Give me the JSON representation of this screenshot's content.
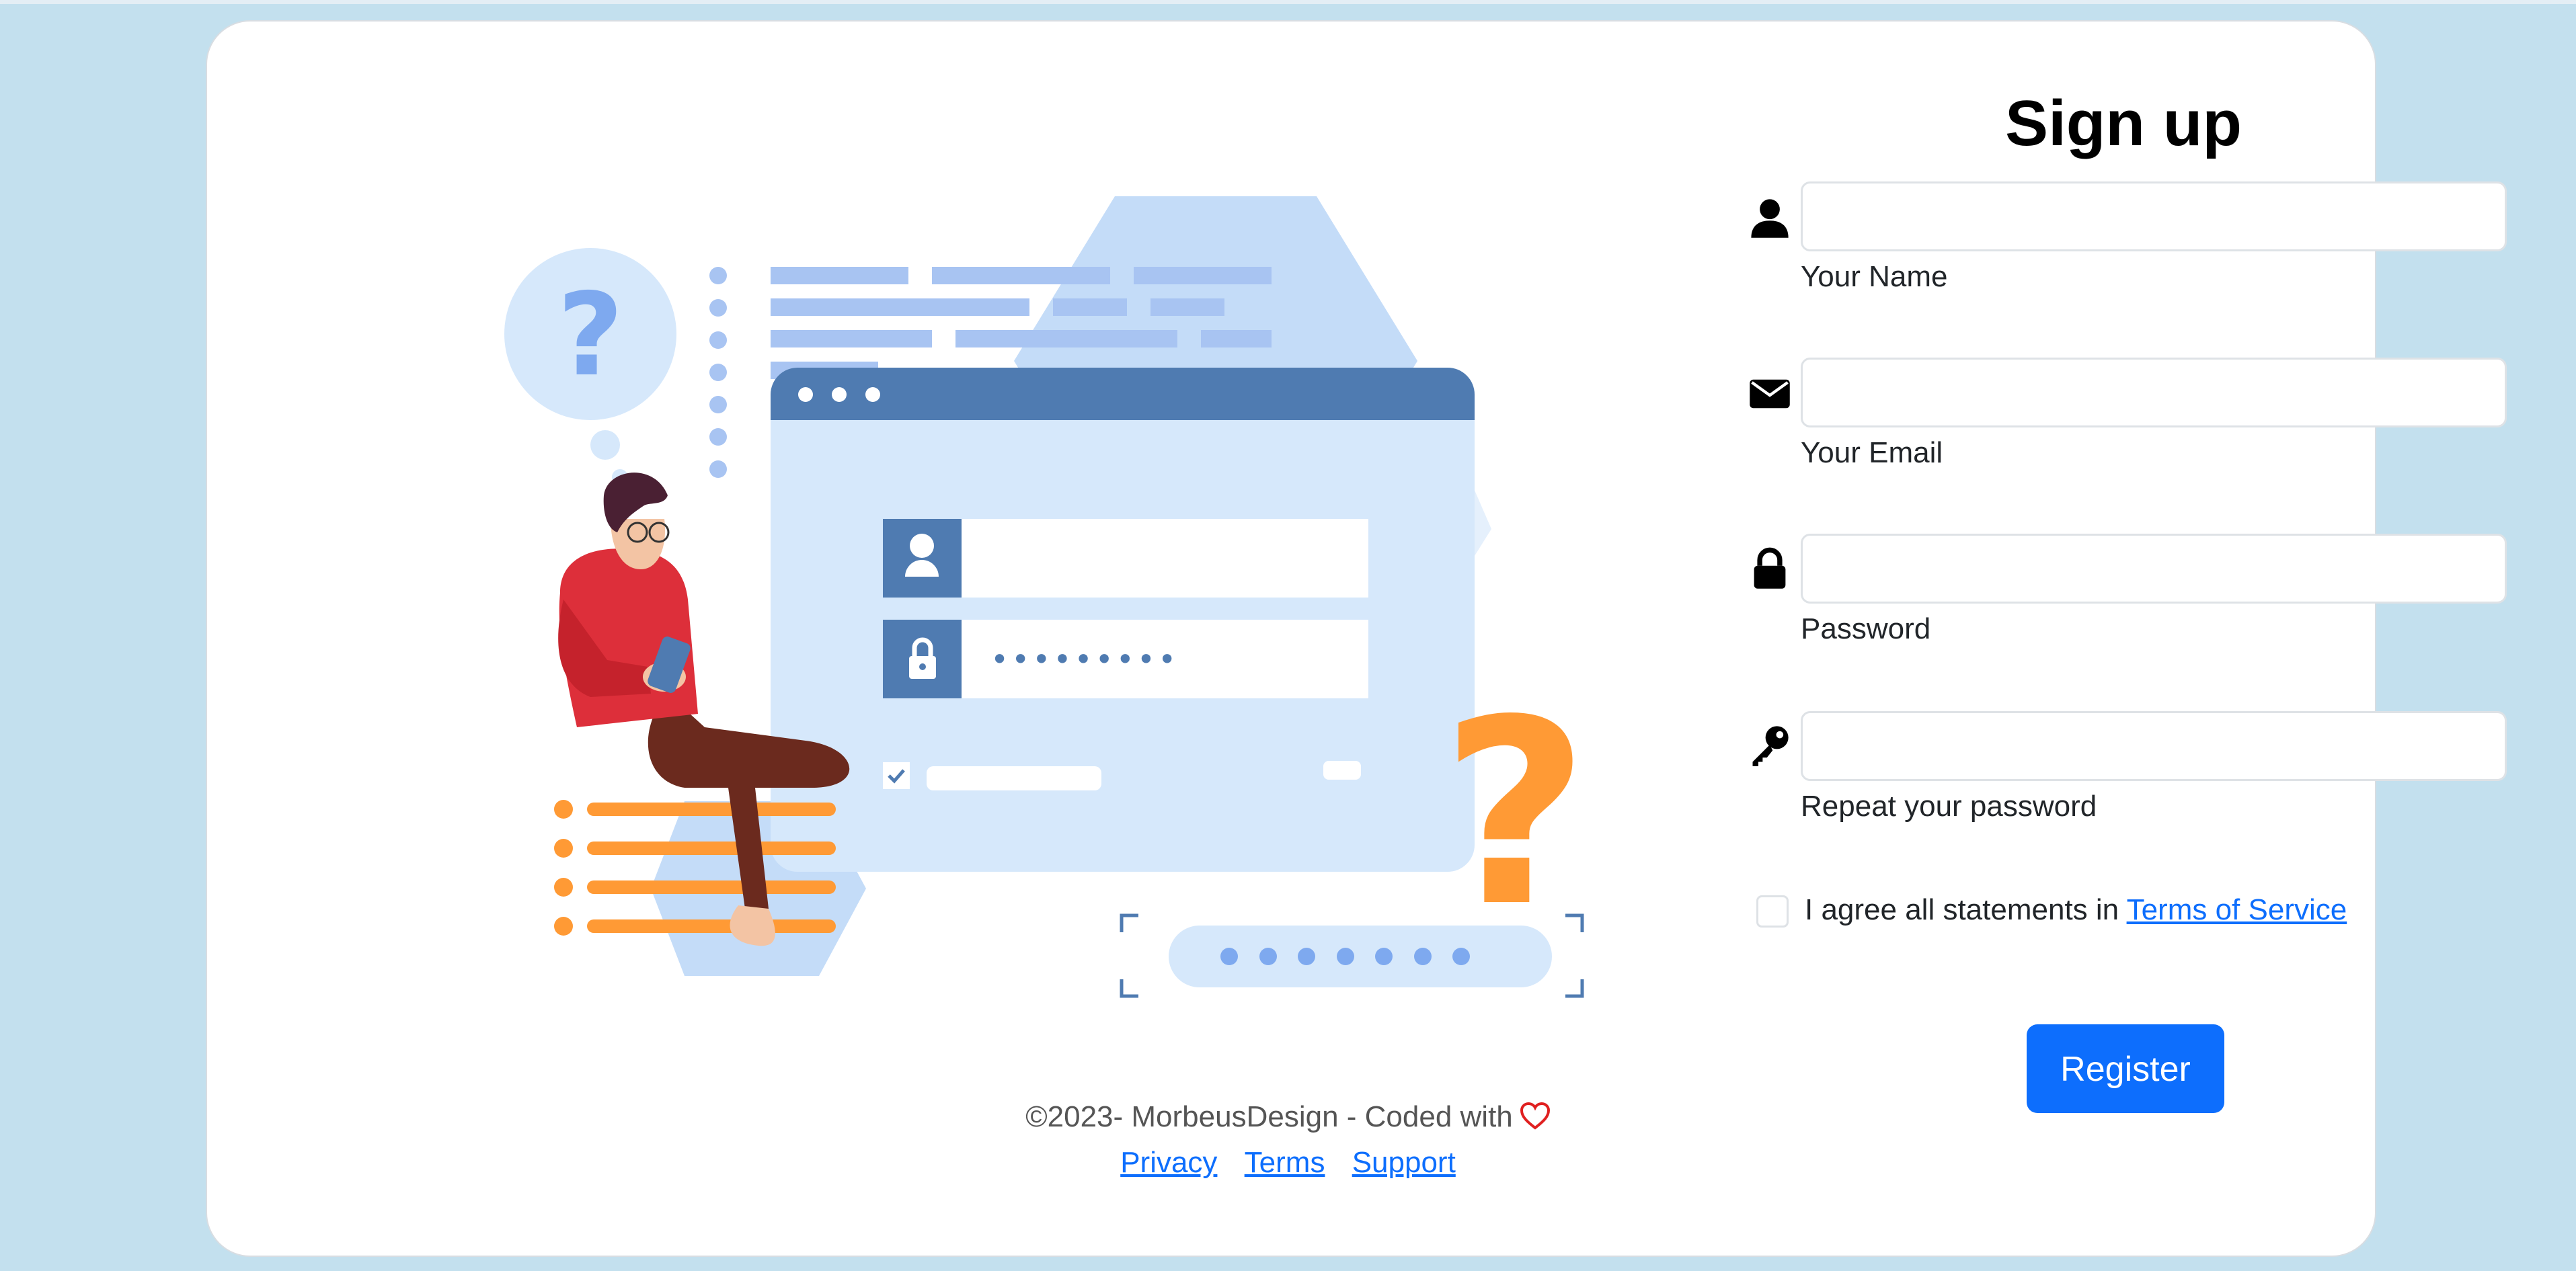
{
  "form": {
    "title": "Sign up",
    "fields": [
      {
        "label": "Your Name",
        "value": "",
        "icon": "user-icon"
      },
      {
        "label": "Your Email",
        "value": "",
        "icon": "envelope-icon"
      },
      {
        "label": "Password",
        "value": "",
        "icon": "lock-icon"
      },
      {
        "label": "Repeat your password",
        "value": "",
        "icon": "key-icon"
      }
    ],
    "agree_text": "I agree all statements in ",
    "terms_link": "Terms of Service",
    "agree_checked": false,
    "register_label": "Register"
  },
  "footer": {
    "copyright": "©2023- MorbeusDesign - Coded with",
    "heart_icon": "heart-icon",
    "links": [
      "Privacy",
      "Terms",
      "Support"
    ]
  },
  "colors": {
    "background": "#c3e0ee",
    "card": "#ffffff",
    "primary": "#0d6efd",
    "illustration_blue": "#4f7bb1",
    "illustration_light": "#d6e8fb",
    "illustration_orange": "#ff9a35",
    "heart": "#e02020"
  },
  "illustration": {
    "password_mask": "•••••••••"
  }
}
